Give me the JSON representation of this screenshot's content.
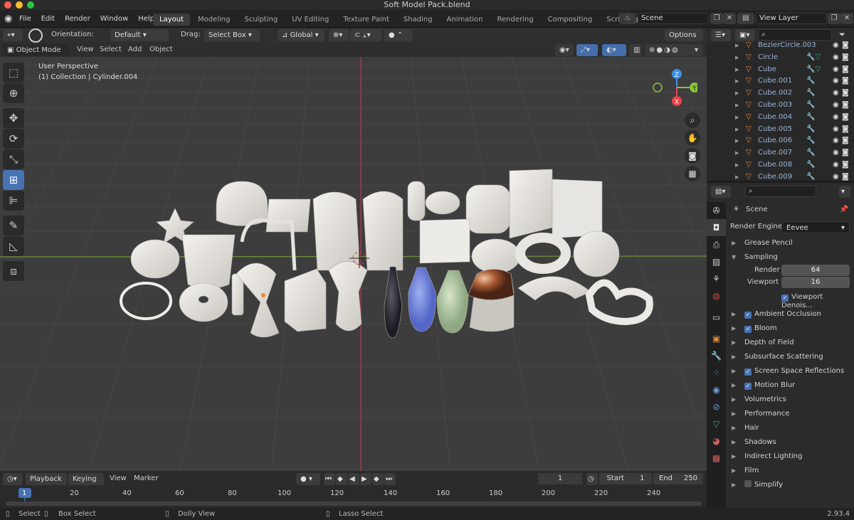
{
  "window_title": "Soft Model Pack.blend",
  "menu": [
    "File",
    "Edit",
    "Render",
    "Window",
    "Help"
  ],
  "workspace_tabs": [
    "Layout",
    "Modeling",
    "Sculpting",
    "UV Editing",
    "Texture Paint",
    "Shading",
    "Animation",
    "Rendering",
    "Compositing",
    "Scripting"
  ],
  "active_workspace": "Layout",
  "scene_name": "Scene",
  "view_layer_name": "View Layer",
  "tool_header": {
    "orientation_label": "Orientation:",
    "orientation_value": "Default",
    "drag_label": "Drag:",
    "drag_value": "Select Box",
    "transform_value": "Global",
    "options_label": "Options"
  },
  "viewport_header": {
    "mode": "Object Mode",
    "menus": [
      "View",
      "Select",
      "Add",
      "Object"
    ]
  },
  "viewport_overlay": {
    "perspective": "User Perspective",
    "collection": "(1) Collection | Cylinder.004"
  },
  "gizmo": {
    "x": "X",
    "y": "Y",
    "z": "Z"
  },
  "outliner": {
    "items": [
      {
        "name": "BezierCircle.003"
      },
      {
        "name": "Circle"
      },
      {
        "name": "Cube"
      },
      {
        "name": "Cube.001"
      },
      {
        "name": "Cube.002"
      },
      {
        "name": "Cube.003"
      },
      {
        "name": "Cube.004"
      },
      {
        "name": "Cube.005"
      },
      {
        "name": "Cube.006"
      },
      {
        "name": "Cube.007"
      },
      {
        "name": "Cube.008"
      },
      {
        "name": "Cube.009"
      }
    ]
  },
  "properties": {
    "breadcrumb": "Scene",
    "render_engine_label": "Render Engine",
    "render_engine_value": "Eevee",
    "grease_pencil": "Grease Pencil",
    "sampling": "Sampling",
    "render_label": "Render",
    "render_value": "64",
    "viewport_label": "Viewport",
    "viewport_value": "16",
    "viewport_denoise": "Viewport Denois...",
    "sections": [
      {
        "label": "Ambient Occlusion",
        "checkbox": true
      },
      {
        "label": "Bloom",
        "checkbox": true
      },
      {
        "label": "Depth of Field",
        "checkbox": null
      },
      {
        "label": "Subsurface Scattering",
        "checkbox": null
      },
      {
        "label": "Screen Space Reflections",
        "checkbox": true
      },
      {
        "label": "Motion Blur",
        "checkbox": true
      },
      {
        "label": "Volumetrics",
        "checkbox": null
      },
      {
        "label": "Performance",
        "checkbox": null
      },
      {
        "label": "Hair",
        "checkbox": null
      },
      {
        "label": "Shadows",
        "checkbox": null
      },
      {
        "label": "Indirect Lighting",
        "checkbox": null
      },
      {
        "label": "Film",
        "checkbox": null
      },
      {
        "label": "Simplify",
        "checkbox": false
      }
    ]
  },
  "timeline": {
    "menus": [
      "Playback",
      "Keying",
      "View",
      "Marker"
    ],
    "current_frame": "1",
    "start_label": "Start",
    "start_value": "1",
    "end_label": "End",
    "end_value": "250",
    "ticks": [
      "1",
      "20",
      "40",
      "60",
      "80",
      "100",
      "120",
      "140",
      "160",
      "180",
      "200",
      "220",
      "240"
    ]
  },
  "status_bar": {
    "select": "Select",
    "box_select": "Box Select",
    "dolly_view": "Dolly View",
    "lasso_select": "Lasso Select",
    "version": "2.93.4"
  },
  "colors": {
    "accent": "#4772b3",
    "viewport_bg": "#3d3d3d",
    "x_axis": "#e8444a",
    "y_axis": "#8ac43a",
    "z_axis": "#3a8ee6"
  }
}
